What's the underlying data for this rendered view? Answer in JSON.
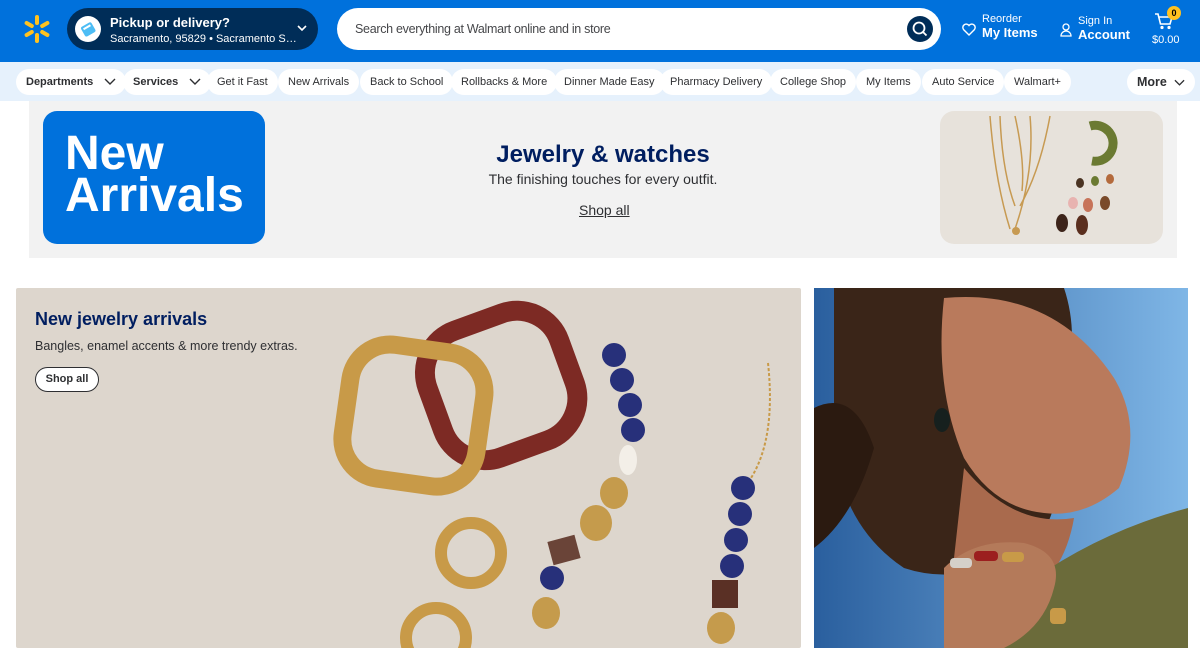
{
  "header": {
    "pickup": {
      "title": "Pickup or delivery?",
      "subtitle": "Sacramento, 95829 • Sacramento Supe..."
    },
    "search": {
      "placeholder": "Search everything at Walmart online and in store"
    },
    "reorder": {
      "line1": "Reorder",
      "line2": "My Items"
    },
    "account": {
      "line1": "Sign In",
      "line2": "Account"
    },
    "cart": {
      "count": "0",
      "total": "$0.00"
    }
  },
  "nav": {
    "departments": "Departments",
    "services": "Services",
    "links": [
      "Get it Fast",
      "New Arrivals",
      "Back to School",
      "Rollbacks & More",
      "Dinner Made Easy",
      "Pharmacy Delivery",
      "College Shop",
      "My Items",
      "Auto Service",
      "Walmart+"
    ],
    "more": "More"
  },
  "banner": {
    "tile_line1": "New",
    "tile_line2": "Arrivals",
    "heading": "Jewelry & watches",
    "subheading": "The finishing touches for every outfit.",
    "link": "Shop all"
  },
  "hero": {
    "heading": "New jewelry arrivals",
    "subheading": "Bangles, enamel accents & more trendy extras.",
    "button": "Shop all"
  },
  "colors": {
    "brand_blue": "#0071dc",
    "navy": "#001e60",
    "spark_yellow": "#ffc220"
  }
}
